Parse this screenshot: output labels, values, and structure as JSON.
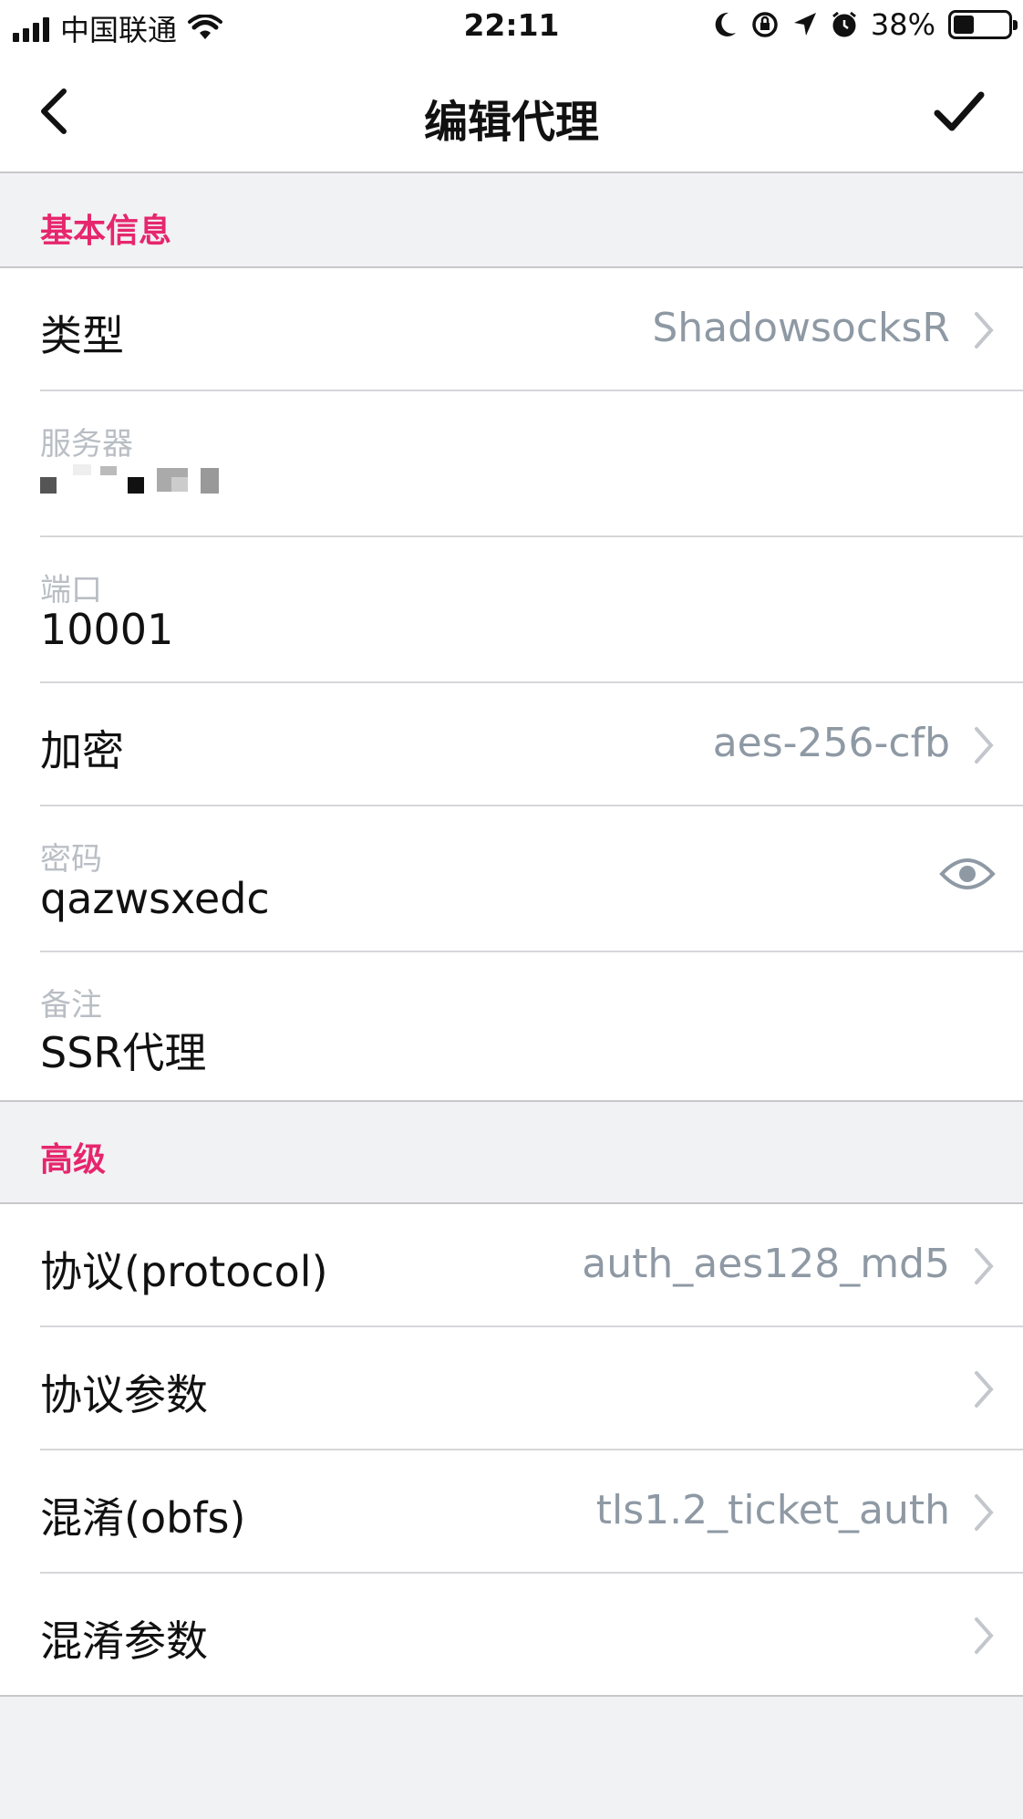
{
  "status_bar": {
    "carrier": "中国联通",
    "time": "22:11",
    "battery_percent": "38%",
    "battery_level": 0.38
  },
  "nav": {
    "title": "编辑代理"
  },
  "sections": {
    "basic_title": "基本信息",
    "advanced_title": "高级"
  },
  "basic": {
    "type_label": "类型",
    "type_value": "ShadowsocksR",
    "server_label": "服务器",
    "port_label": "端口",
    "port_value": "10001",
    "encrypt_label": "加密",
    "encrypt_value": "aes-256-cfb",
    "password_label": "密码",
    "password_value": "qazwsxedc",
    "remark_label": "备注",
    "remark_value": "SSR代理"
  },
  "advanced": {
    "protocol_label": "协议(protocol)",
    "protocol_value": "auth_aes128_md5",
    "protocol_param_label": "协议参数",
    "obfs_label": "混淆(obfs)",
    "obfs_value": "tls1.2_ticket_auth",
    "obfs_param_label": "混淆参数"
  },
  "colors": {
    "accent": "#e6266d",
    "value_gray": "#8e99a4",
    "background": "#f1f2f4"
  },
  "icons": {
    "back": "back-chevron-icon",
    "done": "checkmark-icon",
    "chevron": "chevron-right-icon",
    "eye": "eye-icon"
  }
}
